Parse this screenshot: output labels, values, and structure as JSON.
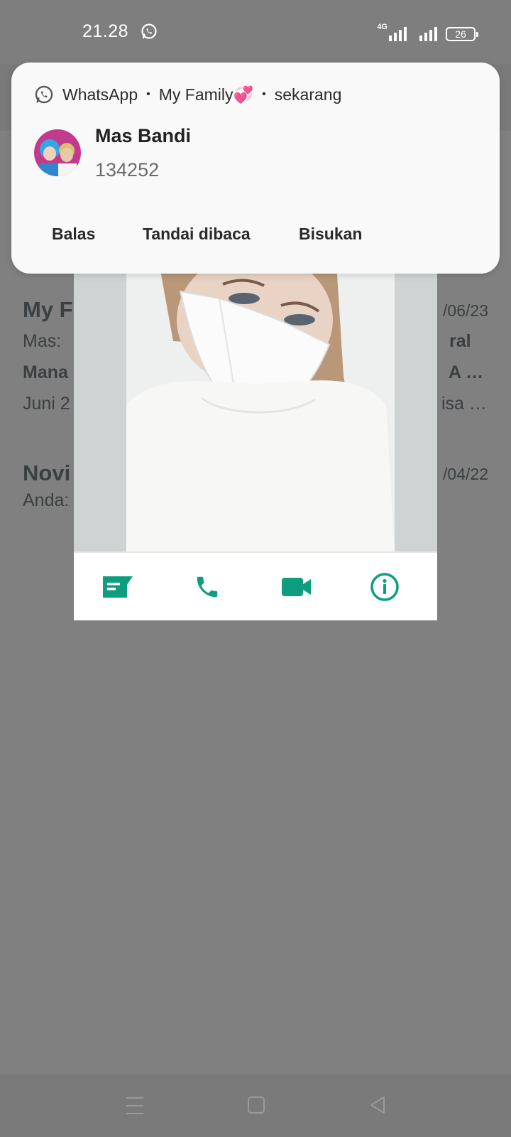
{
  "status_bar": {
    "time": "21.28",
    "network": "4G",
    "battery": "26"
  },
  "notification": {
    "app": "WhatsApp",
    "group": "My Family💞",
    "when": "sekarang",
    "sender": "Mas Bandi",
    "message": "134252",
    "actions": [
      "Balas",
      "Tandai dibaca",
      "Bisukan"
    ]
  },
  "chat_list": [
    {
      "name": "My F",
      "time": "/06/23",
      "line1_prefix": "Mas: ",
      "line1_suffix": "ral",
      "line2_prefix": "Mana",
      "line2_suffix": "A …",
      "line3_prefix": "Juni 2",
      "line3_suffix": "isa …"
    },
    {
      "name": "Novi",
      "time": "/04/22",
      "line1_prefix": "Anda:"
    }
  ],
  "photo_popup": {
    "actions": [
      "message-icon",
      "phone-icon",
      "video-icon",
      "info-icon"
    ],
    "accent_color": "#0f9d7f"
  },
  "nav": {
    "buttons": [
      "menu",
      "home",
      "back"
    ]
  }
}
